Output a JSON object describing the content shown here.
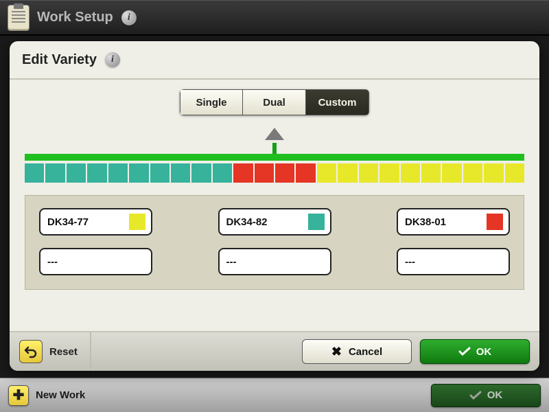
{
  "header": {
    "title": "Work Setup"
  },
  "footer": {
    "new_work_label": "New Work",
    "ok_label": "OK"
  },
  "modal": {
    "title": "Edit Variety",
    "tabs": {
      "single": "Single",
      "dual": "Dual",
      "custom": "Custom",
      "active": "custom"
    },
    "strip_cells": [
      "teal",
      "teal",
      "teal",
      "teal",
      "teal",
      "teal",
      "teal",
      "teal",
      "teal",
      "teal",
      "red",
      "red",
      "red",
      "red",
      "yel",
      "yel",
      "yel",
      "yel",
      "yel",
      "yel",
      "yel",
      "yel",
      "yel",
      "yel"
    ],
    "varieties": [
      {
        "name": "DK34-77",
        "color": "yel"
      },
      {
        "name": "DK34-82",
        "color": "teal"
      },
      {
        "name": "DK38-01",
        "color": "red"
      }
    ],
    "empty_label": "---",
    "buttons": {
      "reset": "Reset",
      "cancel": "Cancel",
      "ok": "OK"
    }
  }
}
